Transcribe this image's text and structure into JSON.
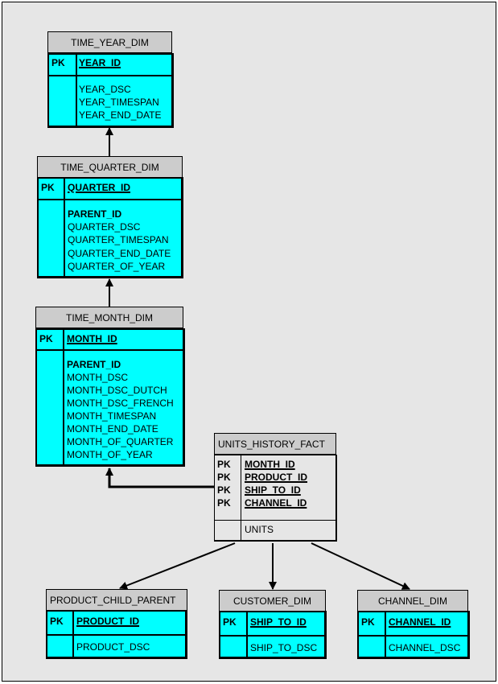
{
  "diagram": {
    "type": "star-schema",
    "colors": {
      "background": "#e6e6e6",
      "header": "#cccccc",
      "dimension_body": "#00ffff",
      "fact_body": "#e6e6e6",
      "line": "#000000"
    },
    "pk_label": "PK",
    "tables": {
      "time_year_dim": {
        "name": "TIME_YEAR_DIM",
        "keys": [
          "YEAR_ID"
        ],
        "attributes": [
          "YEAR_DSC",
          "YEAR_TIMESPAN",
          "YEAR_END_DATE"
        ]
      },
      "time_quarter_dim": {
        "name": "TIME_QUARTER_DIM",
        "keys": [
          "QUARTER_ID"
        ],
        "foreign_keys": [
          "PARENT_ID"
        ],
        "attributes": [
          "QUARTER_DSC",
          "QUARTER_TIMESPAN",
          "QUARTER_END_DATE",
          "QUARTER_OF_YEAR"
        ]
      },
      "time_month_dim": {
        "name": "TIME_MONTH_DIM",
        "keys": [
          "MONTH_ID"
        ],
        "foreign_keys": [
          "PARENT_ID"
        ],
        "attributes": [
          "MONTH_DSC",
          "MONTH_DSC_DUTCH",
          "MONTH_DSC_FRENCH",
          "MONTH_TIMESPAN",
          "MONTH_END_DATE",
          "MONTH_OF_QUARTER",
          "MONTH_OF_YEAR"
        ]
      },
      "units_history_fact": {
        "name": "UNITS_HISTORY_FACT",
        "keys": [
          "MONTH_ID",
          "PRODUCT_ID",
          "SHIP_TO_ID",
          "CHANNEL_ID"
        ],
        "attributes": [
          "UNITS"
        ]
      },
      "product_child_parent": {
        "name": "PRODUCT_CHILD_PARENT",
        "keys": [
          "PRODUCT_ID"
        ],
        "attributes": [
          "PRODUCT_DSC"
        ]
      },
      "customer_dim": {
        "name": "CUSTOMER_DIM",
        "keys": [
          "SHIP_TO_ID"
        ],
        "attributes": [
          "SHIP_TO_DSC"
        ]
      },
      "channel_dim": {
        "name": "CHANNEL_DIM",
        "keys": [
          "CHANNEL_ID"
        ],
        "attributes": [
          "CHANNEL_DSC"
        ]
      }
    },
    "relationships": [
      {
        "from": "TIME_QUARTER_DIM",
        "to": "TIME_YEAR_DIM"
      },
      {
        "from": "TIME_MONTH_DIM",
        "to": "TIME_QUARTER_DIM"
      },
      {
        "from": "UNITS_HISTORY_FACT",
        "to": "TIME_MONTH_DIM"
      },
      {
        "from": "UNITS_HISTORY_FACT",
        "to": "PRODUCT_CHILD_PARENT"
      },
      {
        "from": "UNITS_HISTORY_FACT",
        "to": "CUSTOMER_DIM"
      },
      {
        "from": "UNITS_HISTORY_FACT",
        "to": "CHANNEL_DIM"
      }
    ]
  }
}
